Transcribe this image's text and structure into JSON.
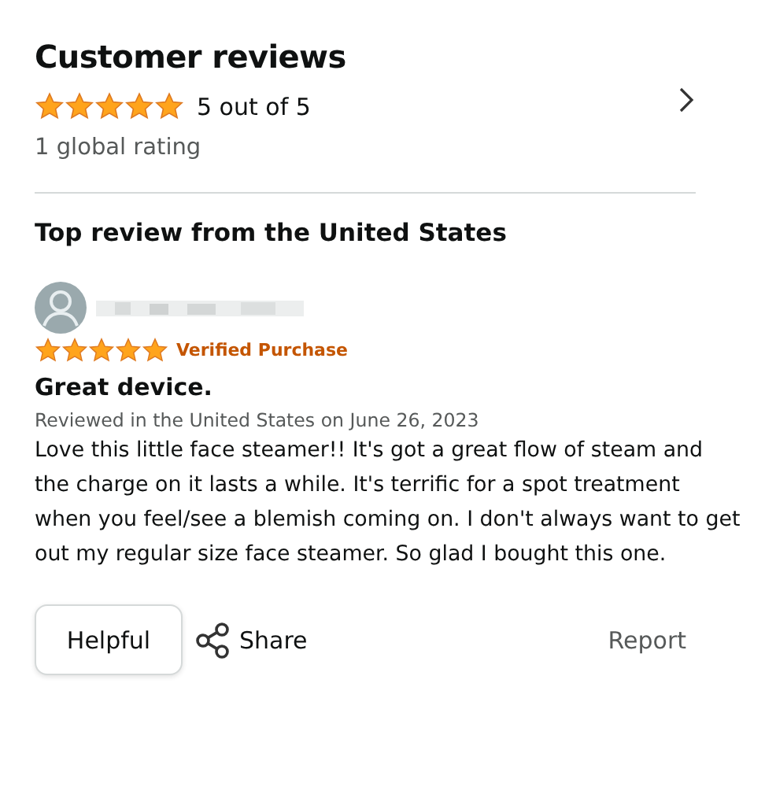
{
  "header": {
    "title": "Customer reviews",
    "stars": 5,
    "rating_text": "5 out of 5",
    "global_ratings": "1 global rating"
  },
  "top_review_heading": "Top review from the United States",
  "review": {
    "stars": 5,
    "badge": "Verified Purchase",
    "title": "Great device.",
    "meta": "Reviewed in the United States on June 26, 2023",
    "body": "Love this little face steamer!! It's got a great flow of steam and the charge on it lasts a while. It's terrific for a spot treatment when you feel/see a blemish coming on. I don't always want to get out my regular size face steamer. So glad I bought this one."
  },
  "actions": {
    "helpful": "Helpful",
    "share": "Share",
    "report": "Report"
  }
}
